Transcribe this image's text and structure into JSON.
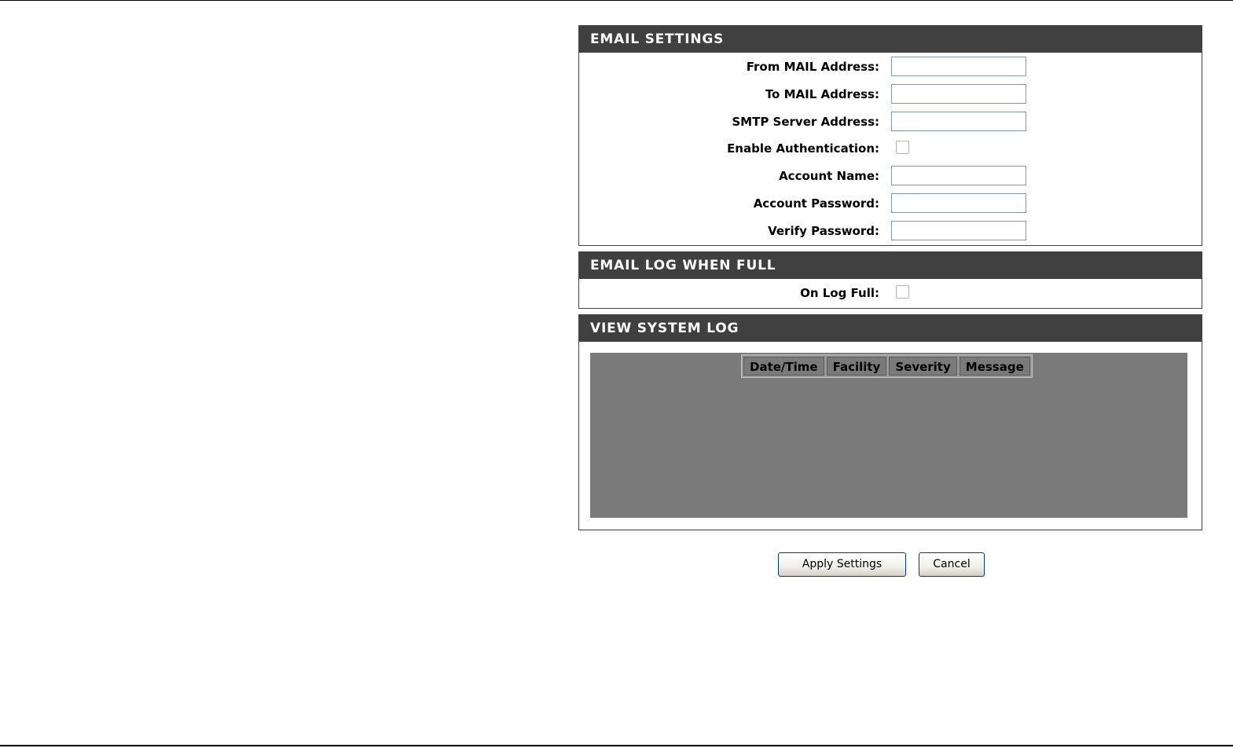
{
  "email_settings": {
    "title": "EMAIL SETTINGS",
    "from_label": "From MAIL Address:",
    "from_value": "",
    "to_label": "To MAIL Address:",
    "to_value": "",
    "smtp_label": "SMTP Server Address:",
    "smtp_value": "",
    "auth_label": "Enable Authentication:",
    "auth_checked": false,
    "account_name_label": "Account Name:",
    "account_name_value": "",
    "account_password_label": "Account Password:",
    "account_password_value": "",
    "verify_password_label": "Verify Password:",
    "verify_password_value": ""
  },
  "email_log_full": {
    "title": "EMAIL LOG WHEN FULL",
    "on_log_full_label": "On Log Full:",
    "on_log_full_checked": false
  },
  "system_log": {
    "title": "VIEW SYSTEM LOG",
    "columns": [
      "Date/Time",
      "Facility",
      "Severity",
      "Message"
    ]
  },
  "actions": {
    "apply_label": "Apply Settings",
    "cancel_label": "Cancel"
  }
}
